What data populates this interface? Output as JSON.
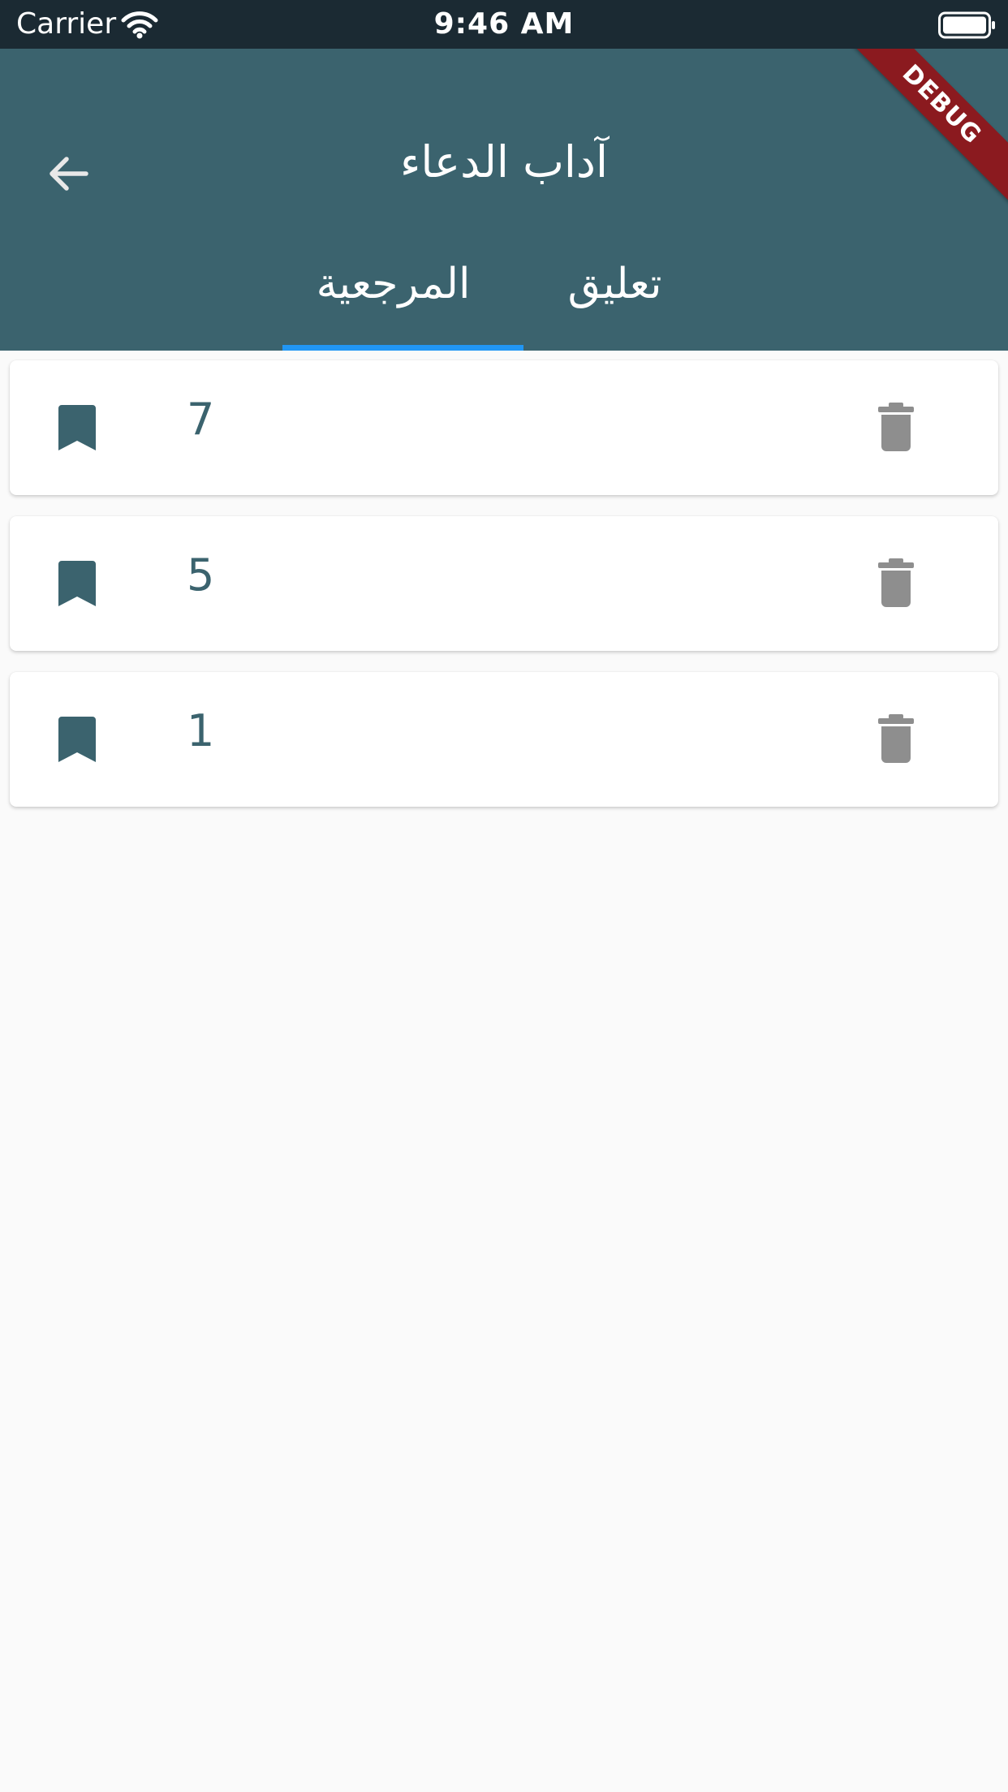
{
  "status_bar": {
    "carrier": "Carrier",
    "time": "9:46 AM"
  },
  "app_bar": {
    "title": "آداب الدعاء",
    "debug_banner": "DEBUG",
    "tabs": [
      {
        "label": "تعليق",
        "selected": false
      },
      {
        "label": "المرجعية",
        "selected": true
      }
    ]
  },
  "bookmarks": [
    {
      "number": "7"
    },
    {
      "number": "5"
    },
    {
      "number": "1"
    }
  ],
  "colors": {
    "app_bar": "#3b636e",
    "status_bar": "#1b2a33",
    "tab_indicator": "#2196f3",
    "accent_text": "#3b636e",
    "delete_icon": "#8e8e8e",
    "debug_banner": "#8b1a1f",
    "background": "#fafafa"
  },
  "icons": {
    "back": "arrow-back-icon",
    "bookmark": "bookmark-icon",
    "delete": "trash-icon",
    "wifi": "wifi-icon",
    "battery": "battery-icon"
  }
}
